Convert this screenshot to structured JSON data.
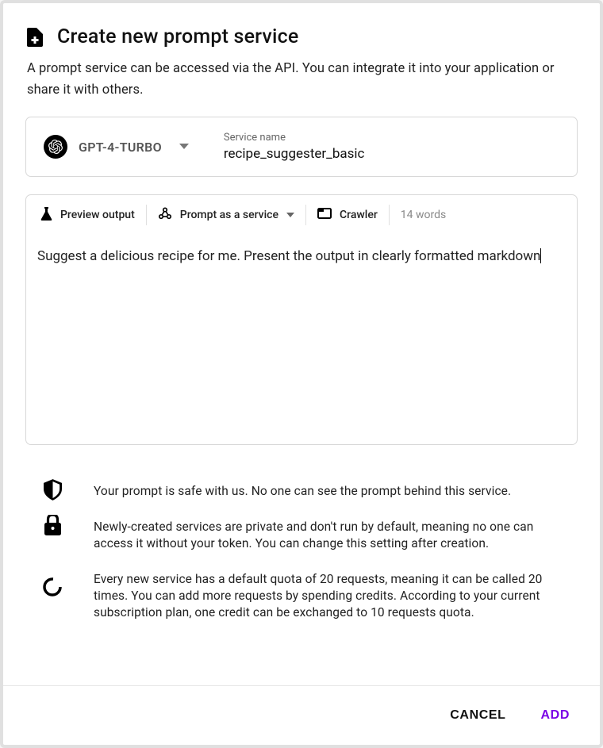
{
  "header": {
    "title": "Create new prompt service",
    "subtitle": "A prompt service can be accessed via the API. You can integrate it into your application or share it with others."
  },
  "config": {
    "model_label": "GPT-4-TURBO",
    "service_name_label": "Service name",
    "service_name_value": "recipe_suggester_basic"
  },
  "toolbar": {
    "preview_label": "Preview output",
    "prompt_service_label": "Prompt as a service",
    "crawler_label": "Crawler",
    "word_count": "14 words"
  },
  "prompt_text": "Suggest a delicious recipe for me. Present the output in clearly formatted markdown",
  "info": {
    "safe": "Your prompt is safe with us. No one can see the prompt behind this service.",
    "private": "Newly-created services are private and don't run by default, meaning no one can access it without your token. You can change this setting after creation.",
    "quota": "Every new service has a default quota of 20 requests, meaning it can be called 20 times. You can add more requests by spending credits. According to your current subscription plan, one credit can be exchanged to 10 requests quota."
  },
  "footer": {
    "cancel_label": "CANCEL",
    "add_label": "ADD"
  }
}
